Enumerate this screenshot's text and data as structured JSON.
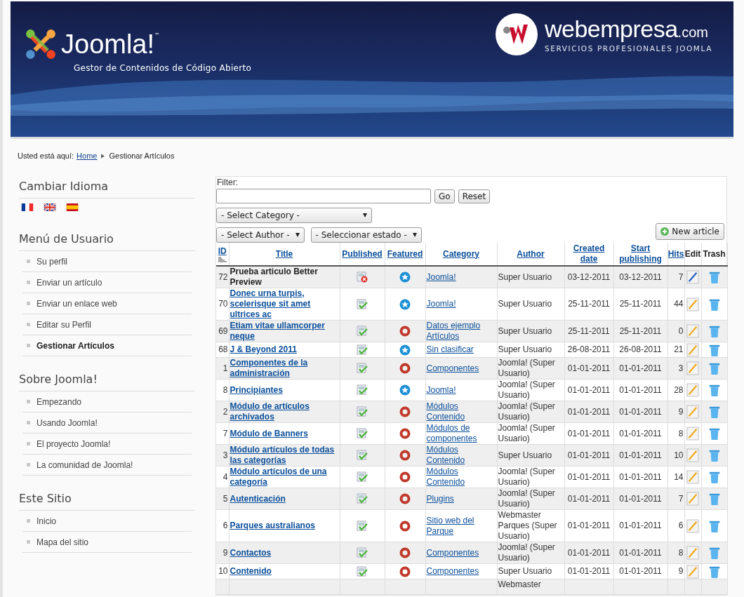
{
  "header": {
    "logo_text": "Joomla!",
    "logo_mark": "™",
    "tagline": "Gestor de Contenidos de Código Abierto",
    "partner_name": "webempresa",
    "partner_suffix": ".com",
    "partner_tagline": "SERVICIOS PROFESIONALES JOOMLA"
  },
  "breadcrumb": {
    "label": "Usted está aquí:",
    "items": [
      {
        "text": "Home",
        "kind": "link"
      },
      {
        "text": "Gestionar Artículos",
        "kind": "current"
      }
    ]
  },
  "sidebar": [
    {
      "title": "Cambiar Idioma",
      "kind": "languages"
    },
    {
      "title": "Menú de Usuario",
      "kind": "menu",
      "items": [
        {
          "label": "Su perfil",
          "selected": false
        },
        {
          "label": "Enviar un artículo",
          "selected": false
        },
        {
          "label": "Enviar un enlace web",
          "selected": false
        },
        {
          "label": "Editar su Perfil",
          "selected": false
        },
        {
          "label": "Gestionar Artículos",
          "selected": true
        }
      ]
    },
    {
      "title": "Sobre Joomla!",
      "kind": "menu",
      "items": [
        {
          "label": "Empezando",
          "selected": false
        },
        {
          "label": "Usando Joomla!",
          "selected": false
        },
        {
          "label": "El proyecto Joomla!",
          "selected": false
        },
        {
          "label": "La comunidad de Joomla!",
          "selected": false
        }
      ]
    },
    {
      "title": "Este Sitio",
      "kind": "menu",
      "items": [
        {
          "label": "Inicio",
          "selected": false
        },
        {
          "label": "Mapa del sitio",
          "selected": false
        }
      ]
    }
  ],
  "filter": {
    "label": "Filter:",
    "go": "Go",
    "reset": "Reset",
    "category": "- Select Category -",
    "author": "- Select Author -",
    "state": "- Seleccionar estado -",
    "new_article": "New article"
  },
  "table": {
    "columns": [
      {
        "label": "ID",
        "kind": "link",
        "sorted": true
      },
      {
        "label": "Title",
        "kind": "link",
        "sorted": false
      },
      {
        "label": "Published",
        "kind": "link",
        "sorted": false
      },
      {
        "label": "Featured",
        "kind": "link",
        "sorted": false
      },
      {
        "label": "Category",
        "kind": "link",
        "sorted": false
      },
      {
        "label": "Author",
        "kind": "link",
        "sorted": false
      },
      {
        "label": "Created date",
        "kind": "link",
        "sorted": false
      },
      {
        "label": "Start publishing",
        "kind": "link",
        "sorted": false
      },
      {
        "label": "Hits",
        "kind": "link",
        "sorted": false
      },
      {
        "label": "Edit",
        "kind": "plain",
        "sorted": false
      },
      {
        "label": "Trash",
        "kind": "plain",
        "sorted": false
      }
    ],
    "rows": [
      {
        "id": "72",
        "title": "Prueba articulo Better Preview",
        "published": false,
        "featured": true,
        "category": "Joomla!",
        "author": "Super Usuario",
        "created": "03-12-2011",
        "start": "03-12-2011",
        "hits": "7"
      },
      {
        "id": "70",
        "title": "Donec urna turpis, scelerisque sit amet ultrices ac",
        "published": true,
        "featured": true,
        "category": "Joomla!",
        "author": "Super Usuario",
        "created": "25-11-2011",
        "start": "25-11-2011",
        "hits": "44"
      },
      {
        "id": "69",
        "title": "Etiam vitae ullamcorper neque",
        "published": true,
        "featured": false,
        "category": "Datos ejemplo Artículos",
        "author": "Super Usuario",
        "created": "25-11-2011",
        "start": "25-11-2011",
        "hits": "0"
      },
      {
        "id": "68",
        "title": "J & Beyond 2011",
        "published": true,
        "featured": true,
        "category": "Sin clasificar",
        "author": "Super Usuario",
        "created": "26-08-2011",
        "start": "26-08-2011",
        "hits": "21"
      },
      {
        "id": "1",
        "title": "Componentes de la administración",
        "published": true,
        "featured": false,
        "category": "Componentes",
        "author": "Joomla! (Super Usuario)",
        "created": "01-01-2011",
        "start": "01-01-2011",
        "hits": "3"
      },
      {
        "id": "8",
        "title": "Principiantes",
        "published": true,
        "featured": true,
        "category": "Joomla!",
        "author": "Joomla! (Super Usuario)",
        "created": "01-01-2011",
        "start": "01-01-2011",
        "hits": "28"
      },
      {
        "id": "2",
        "title": "Módulo de artículos archivados",
        "published": true,
        "featured": false,
        "category": "Módulos Contenido",
        "author": "Joomla! (Super Usuario)",
        "created": "01-01-2011",
        "start": "01-01-2011",
        "hits": "9"
      },
      {
        "id": "7",
        "title": "Módulo de Banners",
        "published": true,
        "featured": false,
        "category": "Módulos de componentes",
        "author": "Joomla! (Super Usuario)",
        "created": "01-01-2011",
        "start": "01-01-2011",
        "hits": "8"
      },
      {
        "id": "3",
        "title": "Módulo artículos de todas las categorías",
        "published": true,
        "featured": false,
        "category": "Módulos Contenido",
        "author": "Super Usuario",
        "created": "01-01-2011",
        "start": "01-01-2011",
        "hits": "10"
      },
      {
        "id": "4",
        "title": "Módulo artículos de una categoría",
        "published": true,
        "featured": false,
        "category": "Módulos Contenido",
        "author": "Joomla! (Super Usuario)",
        "created": "01-01-2011",
        "start": "01-01-2011",
        "hits": "14"
      },
      {
        "id": "5",
        "title": "Autenticación",
        "published": true,
        "featured": false,
        "category": "Plugins",
        "author": "Joomla! (Super Usuario)",
        "created": "01-01-2011",
        "start": "01-01-2011",
        "hits": "7"
      },
      {
        "id": "6",
        "title": "Parques australianos",
        "published": true,
        "featured": false,
        "category": "Sitio web del Parque",
        "author": "Webmaster Parques (Super Usuario)",
        "created": "01-01-2011",
        "start": "01-01-2011",
        "hits": "6"
      },
      {
        "id": "9",
        "title": "Contactos",
        "published": true,
        "featured": false,
        "category": "Componentes",
        "author": "Joomla! (Super Usuario)",
        "created": "01-01-2011",
        "start": "01-01-2011",
        "hits": "8"
      },
      {
        "id": "10",
        "title": "Contenido",
        "published": true,
        "featured": false,
        "category": "Componentes",
        "author": "Super Usuario",
        "created": "01-01-2011",
        "start": "01-01-2011",
        "hits": "9"
      }
    ],
    "cut_row": {
      "author": "Webmaster"
    }
  }
}
